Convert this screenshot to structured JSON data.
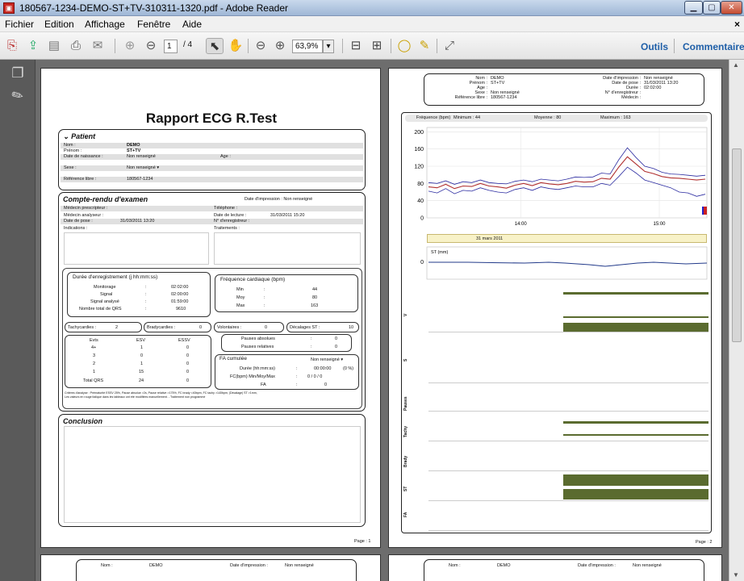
{
  "window": {
    "title": "180567-1234-DEMO-ST+TV-310311-1320.pdf - Adobe Reader",
    "app_icon": "pdf-icon"
  },
  "menu": [
    "Fichier",
    "Edition",
    "Affichage",
    "Fenêtre",
    "Aide"
  ],
  "toolbar": {
    "page_current": "1",
    "page_total": "/ 4",
    "zoom": "63,9%",
    "outils": "Outils",
    "commentaire": "Commentaire"
  },
  "report": {
    "title": "Rapport ECG R.Test",
    "patient": {
      "section": "Patient",
      "rows": [
        {
          "label": "Nom :",
          "value": "DEMO"
        },
        {
          "label": "Prénom :",
          "value": "ST+TV"
        },
        {
          "label": "Date de naissance :",
          "value": "Non renseigné",
          "extra_label": "Age :"
        },
        {
          "label": "Sexe :",
          "value": "Non renseigné"
        },
        {
          "label": "Référence libre :",
          "value": "180567-1234"
        }
      ]
    },
    "exam": {
      "section": "Compte-rendu d'examen",
      "print_date": "Date d'impression : Non renseigné",
      "left": [
        "Médecin prescripteur :",
        "Médecin analyseur :",
        "Date de pose :",
        "Indications :"
      ],
      "pose_value": "31/03/2011 13:20",
      "right": [
        "Téléphone :",
        "Date de lecture :",
        "N° d'enregistreur :",
        "Traitements :"
      ],
      "lecture_value": "31/03/2011 15:20"
    },
    "duree": {
      "title": "Durée d'enregistrement (j hh:mm:ss)",
      "rows": [
        {
          "label": "Monitorage",
          "value": "02:02:00"
        },
        {
          "label": "Signal",
          "value": "02:00:00"
        },
        {
          "label": "Signal analysé",
          "value": "01:59:00"
        },
        {
          "label": "Nombre total de QRS",
          "value": "9610"
        }
      ]
    },
    "freq": {
      "title": "Fréquence cardiaque (bpm)",
      "rows": [
        {
          "label": "Min",
          "value": "44"
        },
        {
          "label": "Moy",
          "value": "80"
        },
        {
          "label": "Max",
          "value": "163"
        }
      ]
    },
    "counts": {
      "tachy_label": "Tachycardies :",
      "tachy": "2",
      "brady_label": "Bradycardies :",
      "brady": "0",
      "volont_label": "Volontaires :",
      "volont": "0",
      "decal_label": "Décalages ST :",
      "decal": "10"
    },
    "evts": {
      "headers": [
        "Evts",
        "ESV",
        "ESSV"
      ],
      "rows": [
        [
          "4+",
          "1",
          "0"
        ],
        [
          "3",
          "0",
          "0"
        ],
        [
          "2",
          "1",
          "0"
        ],
        [
          "1",
          "15",
          "0"
        ],
        [
          "Total QRS",
          "24",
          "0"
        ]
      ]
    },
    "pauses": {
      "abs_label": "Pauses absolues",
      "abs": "0",
      "rel_label": "Pauses relatives",
      "rel": "0"
    },
    "fa": {
      "title": "FA cumulée",
      "status": "Non renseigné",
      "duree_label": "Durée  (hh:mm:ss)",
      "duree": "00:00:00",
      "duree_pct": "(0 %)",
      "fc_label": "FC(bpm) Min/Moy/Max",
      "fc": "0   /   0   /   0",
      "fa_label": "FA",
      "fa": "0"
    },
    "criteria": "Critères d'analyse : Prématurité ESSV 25%, Pause absolue >2s, Pause relative >175%, FC brady <40bpm, FC tachy >140bpm, |Décalage| ST >1mm,",
    "criteria2": "Les valeurs en rouge italique dans les tableaux ont été modifiées manuellement. - Traitement non programmé",
    "conclusion": "Conclusion",
    "page1": "Page : 1"
  },
  "page2": {
    "header": [
      {
        "label": "Nom :",
        "value": "DEMO"
      },
      {
        "label": "Prénom :",
        "value": "ST+TV"
      },
      {
        "label": "Age :",
        "value": ""
      },
      {
        "label": "Sexe :",
        "value": "Non renseigné"
      },
      {
        "label": "Référence libre :",
        "value": "180567-1234"
      }
    ],
    "header_right": [
      {
        "label": "Date d'impression :",
        "value": "Non renseigné"
      },
      {
        "label": "Date de pose :",
        "value": "31/03/2011 13:20"
      },
      {
        "label": "Durée :",
        "value": "02:02:00"
      },
      {
        "label": "N° d'enregistreur :",
        "value": ""
      },
      {
        "label": "Médecin :",
        "value": ""
      }
    ],
    "freq_label": "Fréquence (bpm)",
    "min": "Minimum : 44",
    "moy": "Moyenne : 80",
    "max": "Maximum : 163",
    "date_banner": "31 mars 2011",
    "st_label": "ST (mm)",
    "lanes": [
      "V",
      "S",
      "Pauses",
      "Tachy",
      "Brady",
      "ST",
      "FA"
    ],
    "page2": "Page : 2"
  },
  "page3": {
    "nom_label": "Nom :",
    "nom": "DEMO",
    "date_label": "Date d'impression :",
    "date": "Non renseigné"
  },
  "chart_data": {
    "type": "line",
    "title": "",
    "xlabel": "",
    "ylabel": "Fréquence (bpm)",
    "ylim": [
      0,
      210
    ],
    "yticks": [
      0,
      40,
      80,
      120,
      160,
      200
    ],
    "xticks": [
      "14:00",
      "15:00"
    ],
    "series": [
      {
        "name": "",
        "values": [
          72,
          70,
          78,
          68,
          74,
          73,
          80,
          74,
          72,
          69,
          76,
          80,
          75,
          82,
          79,
          77,
          80,
          85,
          83,
          84,
          92,
          90,
          118,
          142,
          125,
          108,
          103,
          96,
          93,
          92,
          90,
          88,
          90
        ]
      },
      {
        "name": "",
        "values": [
          82,
          80,
          86,
          78,
          84,
          82,
          88,
          82,
          80,
          79,
          85,
          88,
          84,
          90,
          88,
          86,
          90,
          95,
          94,
          95,
          104,
          102,
          135,
          163,
          140,
          120,
          115,
          106,
          102,
          101,
          99,
          97,
          99
        ]
      },
      {
        "name": "",
        "values": [
          62,
          58,
          68,
          56,
          64,
          62,
          70,
          64,
          60,
          58,
          66,
          70,
          64,
          72,
          68,
          66,
          70,
          74,
          72,
          72,
          80,
          76,
          96,
          118,
          104,
          88,
          82,
          76,
          70,
          60,
          58,
          50,
          55
        ]
      }
    ],
    "colors": [
      "#b03030",
      "#2a2aa0",
      "#2a2aa0"
    ]
  },
  "colors": {
    "bar": "#5a6b2f",
    "accent": "#1f5fa8"
  }
}
